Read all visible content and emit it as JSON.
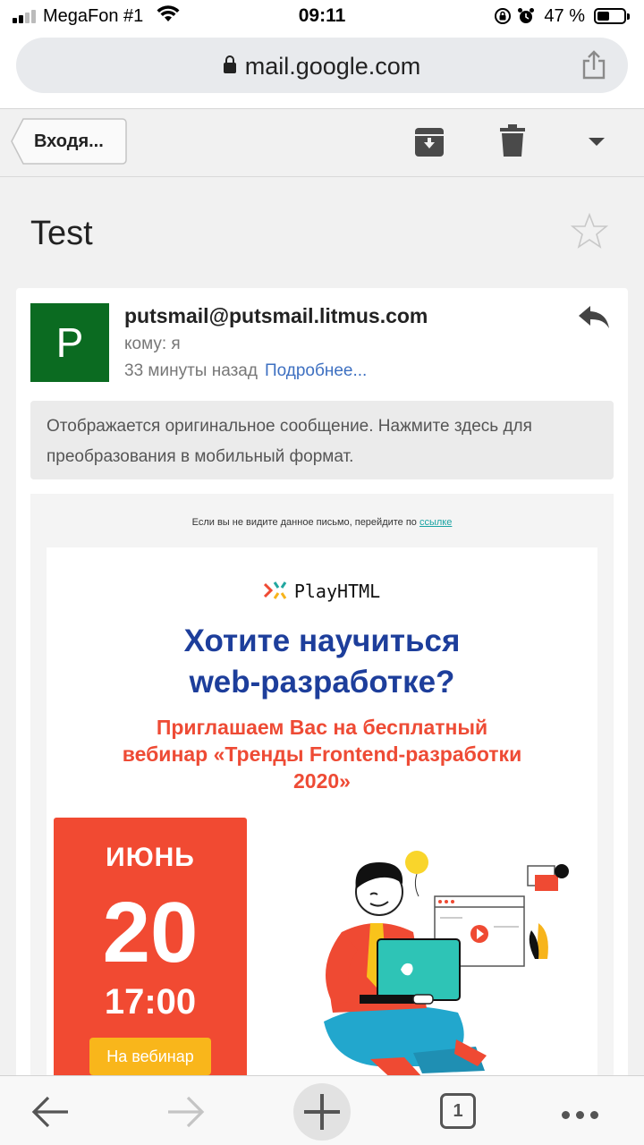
{
  "status_bar": {
    "carrier": "MegaFon #1",
    "time": "09:11",
    "battery_percent": "47 %",
    "battery_level": 0.47,
    "icons": [
      "signal-icon",
      "wifi-icon",
      "rotation-lock-icon",
      "alarm-icon",
      "battery-icon"
    ]
  },
  "browser": {
    "url": "mail.google.com",
    "icons": [
      "lock-icon",
      "share-icon"
    ]
  },
  "toolbar": {
    "back_label": "Входя...",
    "icons": [
      "archive-icon",
      "trash-icon",
      "more-caret-icon"
    ]
  },
  "message": {
    "subject": "Test",
    "avatar_letter": "P",
    "sender": "putsmail@putsmail.litmus.com",
    "to": "кому: я",
    "time": "33 минуты назад",
    "details_link": "Подробнее...",
    "notice": "Отображается оригинальное сообщение. Нажмите здесь для преобразования в мобильный формат."
  },
  "email": {
    "preheader_text": "Если вы не видите данное письмо, перейдите по",
    "preheader_link": "ссылке",
    "logo_text": "PlayHTML",
    "headline_line1": "Хотите научиться",
    "headline_line2": "web-разработке?",
    "sub_line1": "Приглашаем Вас на бесплатный",
    "sub_line2": "вебинар «Тренды Frontend-разработки",
    "sub_line3": "2020»",
    "month": "ИЮНЬ",
    "day": "20",
    "time": "17:00",
    "button_label": "На вебинар",
    "colors": {
      "headline": "#1d3e9b",
      "subheadline": "#ee4b35",
      "date_block": "#f14a32",
      "button": "#f9b61b"
    }
  },
  "bottom_bar": {
    "tab_count": "1",
    "icons": [
      "back-arrow-icon",
      "forward-arrow-icon",
      "new-tab-plus-icon",
      "tabs-icon",
      "more-dots-icon"
    ]
  }
}
